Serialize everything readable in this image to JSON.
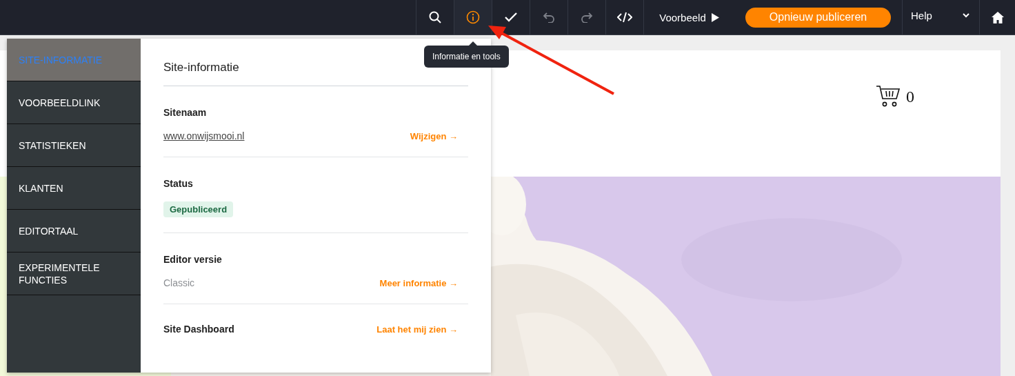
{
  "toolbar": {
    "tools": [
      {
        "kind": "search",
        "selected": false,
        "disabled": false
      },
      {
        "kind": "info",
        "selected": true,
        "disabled": false
      },
      {
        "kind": "check",
        "selected": false,
        "disabled": false
      },
      {
        "kind": "undo",
        "selected": false,
        "disabled": true
      },
      {
        "kind": "redo",
        "selected": false,
        "disabled": true
      },
      {
        "kind": "code",
        "selected": false,
        "disabled": false
      }
    ],
    "preview": "Voorbeeld",
    "publish": "Opnieuw publiceren",
    "help": "Help"
  },
  "tooltip": {
    "text": "Informatie en tools"
  },
  "site": {
    "cart_count": "0"
  },
  "panel": {
    "nav": [
      {
        "label": "SITE-INFORMATIE",
        "selected": true
      },
      {
        "label": "VOORBEELDLINK",
        "selected": false
      },
      {
        "label": "STATISTIEKEN",
        "selected": false
      },
      {
        "label": "KLANTEN",
        "selected": false
      },
      {
        "label": "EDITORTAAL",
        "selected": false
      },
      {
        "label": "EXPERIMENTELE FUNCTIES",
        "selected": false
      }
    ],
    "title": "Site-informatie",
    "sections": [
      {
        "label": "Sitenaam",
        "kind": "link",
        "value": "www.onwijsmooi.nl",
        "action": "Wijzigen →"
      },
      {
        "label": "Status",
        "kind": "badge",
        "value": "Gepubliceerd"
      },
      {
        "label": "Editor versie",
        "kind": "muted",
        "value": "Classic",
        "action": "Meer informatie →"
      },
      {
        "label": "Site Dashboard",
        "kind": "none",
        "action": "Laat het mij zien →"
      }
    ]
  }
}
